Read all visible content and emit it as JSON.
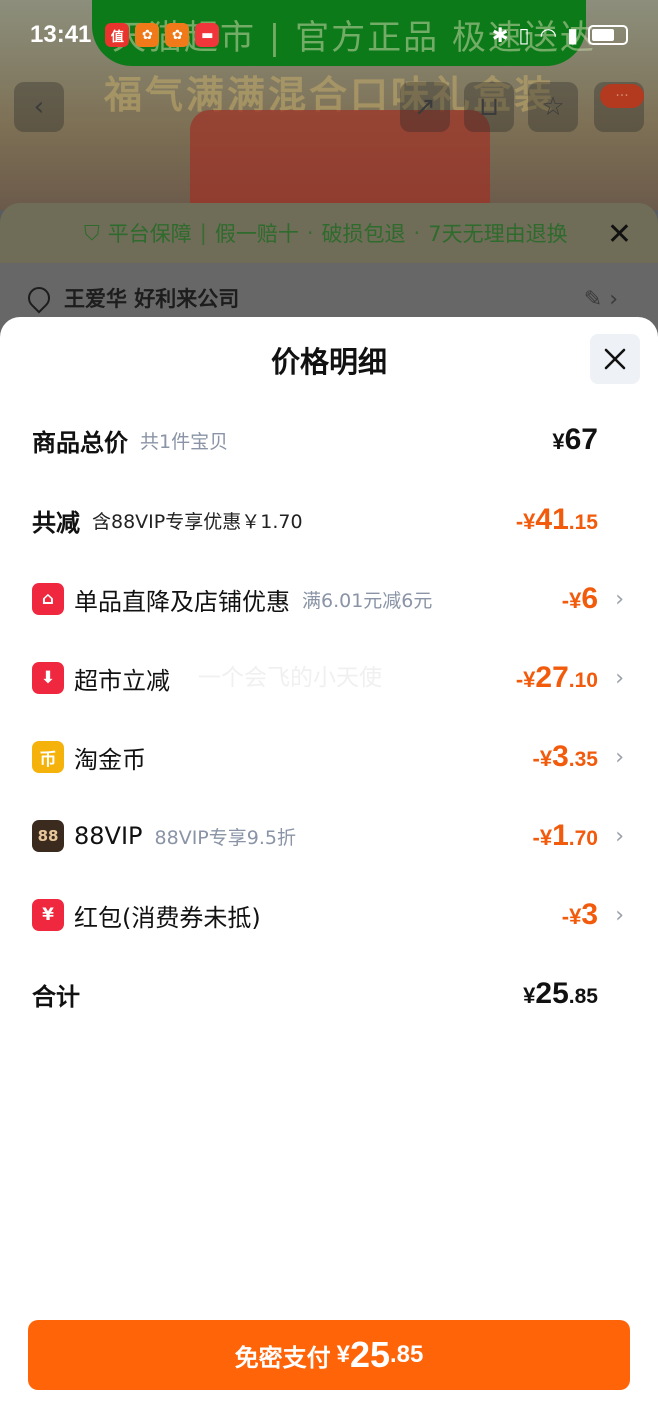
{
  "status_bar": {
    "time": "13:41",
    "apps": [
      {
        "name": "app-red-icon",
        "glyph": "值",
        "color": "#e8342c"
      },
      {
        "name": "app-orange-icon-1",
        "glyph": "●",
        "color": "#f07a1a"
      },
      {
        "name": "app-orange-icon-2",
        "glyph": "●",
        "color": "#f07a1a"
      },
      {
        "name": "app-red-square-icon",
        "glyph": "■",
        "color": "#f0363a"
      }
    ],
    "battery_level": 0.7
  },
  "background": {
    "banner_text": "天猫超市 | 官方正品 极速送达",
    "banner_sub": "福气满满混合口味礼盒装",
    "badge": "···"
  },
  "mid_sheet": {
    "guarantee_label": "平台保障",
    "guarantee_items": [
      "假一赔十",
      "破损包退",
      "7天无理由退换"
    ],
    "address": "王爱华 好利来公司"
  },
  "sheet": {
    "title": "价格明细",
    "rows": [
      {
        "label": "商品总价",
        "sub": "共1件宝贝",
        "sign": "¥",
        "int": "67",
        "dec": "",
        "tone": "black"
      },
      {
        "label": "共减",
        "sub": "含88VIP专享优惠￥1.70",
        "sign": "-¥",
        "int": "41",
        "dec": ".15",
        "tone": "orange"
      },
      {
        "label": "单品直降及店铺优惠",
        "sub": "满6.01元减6元",
        "sign": "-¥",
        "int": "6",
        "dec": "",
        "tone": "orange",
        "icon": "shop-icon",
        "icon_color": "#f0283f"
      },
      {
        "label": "超市立减",
        "sub": "",
        "sign": "-¥",
        "int": "27",
        "dec": ".10",
        "tone": "orange",
        "icon": "down-arrow-icon",
        "icon_color": "#f0283f"
      },
      {
        "label": "淘金币",
        "sub": "",
        "sign": "-¥",
        "int": "3",
        "dec": ".35",
        "tone": "orange",
        "icon": "coin-icon",
        "icon_color": "#f5b20a"
      },
      {
        "label": "88VIP",
        "sub": "88VIP专享9.5折",
        "sign": "-¥",
        "int": "1",
        "dec": ".70",
        "tone": "orange",
        "icon": "vip-88-icon",
        "icon_color": "#3b2a1e"
      },
      {
        "label": "红包(消费券未抵)",
        "sub": "",
        "sign": "-¥",
        "int": "3",
        "dec": "",
        "tone": "orange",
        "icon": "red-packet-icon",
        "icon_color": "#f0283f"
      },
      {
        "label": "合计",
        "sub": "",
        "sign": "¥",
        "int": "25",
        "dec": ".85",
        "tone": "black"
      }
    ],
    "watermark": "一个会飞的小天使",
    "pay_button": {
      "label": "免密支付",
      "sign": "¥",
      "int": "25",
      "dec": ".85"
    }
  },
  "colors": {
    "accent": "#ff6409",
    "discount": "#f25a0c"
  }
}
